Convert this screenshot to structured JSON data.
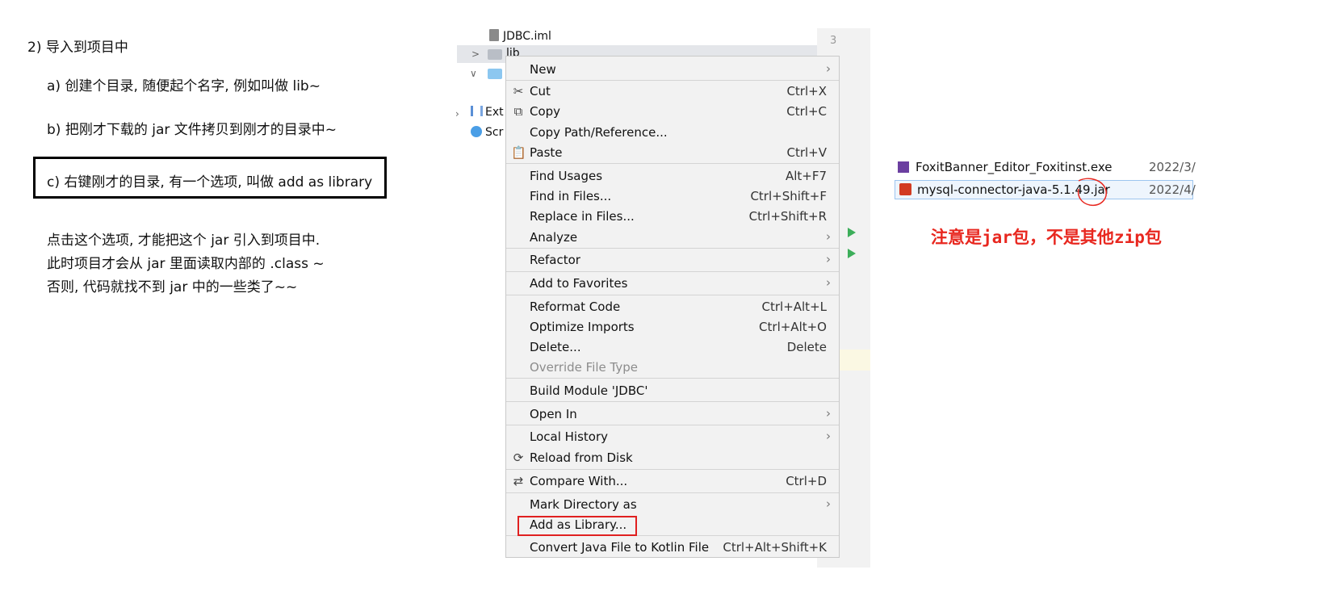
{
  "notes": {
    "title": "2) 导入到项目中",
    "step_a": "a) 创建个目录, 随便起个名字, 例如叫做 lib~",
    "step_b": "b) 把刚才下载的 jar 文件拷贝到刚才的目录中~",
    "step_c": "c) 右键刚才的目录, 有一个选项, 叫做 add as library",
    "explain_1": "点击这个选项, 才能把这个 jar 引入到项目中.",
    "explain_2": "此时项目才会从 jar 里面读取内部的 .class ~",
    "explain_3": "否则, 代码就找不到 jar 中的一些类了~~"
  },
  "tree": {
    "file_iml": "JDBC.iml",
    "folder_lib": "lib",
    "ext_label": "Ext",
    "scr_label": "Scr",
    "line_number": "3"
  },
  "menu": {
    "items": [
      {
        "label": "New",
        "shortcut": "",
        "submenu": "›"
      },
      {
        "label": "Cut",
        "shortcut": "Ctrl+X",
        "icon": "✂"
      },
      {
        "label": "Copy",
        "shortcut": "Ctrl+C",
        "icon": "⧉"
      },
      {
        "label": "Copy Path/Reference...",
        "shortcut": ""
      },
      {
        "label": "Paste",
        "shortcut": "Ctrl+V",
        "icon": "📋"
      },
      {
        "label": "Find Usages",
        "shortcut": "Alt+F7"
      },
      {
        "label": "Find in Files...",
        "shortcut": "Ctrl+Shift+F"
      },
      {
        "label": "Replace in Files...",
        "shortcut": "Ctrl+Shift+R"
      },
      {
        "label": "Analyze",
        "shortcut": "",
        "submenu": "›"
      },
      {
        "label": "Refactor",
        "shortcut": "",
        "submenu": "›"
      },
      {
        "label": "Add to Favorites",
        "shortcut": "",
        "submenu": "›"
      },
      {
        "label": "Reformat Code",
        "shortcut": "Ctrl+Alt+L"
      },
      {
        "label": "Optimize Imports",
        "shortcut": "Ctrl+Alt+O"
      },
      {
        "label": "Delete...",
        "shortcut": "Delete"
      },
      {
        "label": "Override File Type",
        "shortcut": ""
      },
      {
        "label": "Build Module 'JDBC'",
        "shortcut": ""
      },
      {
        "label": "Open In",
        "shortcut": "",
        "submenu": "›"
      },
      {
        "label": "Local History",
        "shortcut": "",
        "submenu": "›"
      },
      {
        "label": "Reload from Disk",
        "shortcut": "",
        "icon": "⟳"
      },
      {
        "label": "Compare With...",
        "shortcut": "Ctrl+D",
        "icon": "⇄"
      },
      {
        "label": "Mark Directory as",
        "shortcut": "",
        "submenu": "›"
      },
      {
        "label": "Add as Library...",
        "shortcut": ""
      },
      {
        "label": "Convert Java File to Kotlin File",
        "shortcut": "Ctrl+Alt+Shift+K"
      }
    ]
  },
  "files": {
    "partial_name": "FoxitBanner_Editor_Foxitinst.exe",
    "partial_date": "2022/3/",
    "jar_name": "mysql-connector-java-5.1.49.jar",
    "jar_date": "2022/4/"
  },
  "annotation": "注意是jar包，不是其他zip包",
  "colors": {
    "annotation_red": "#e8271f",
    "highlight_box": "#e02020",
    "menu_bg": "#f2f2f2",
    "run_arrow": "#3cae5a"
  }
}
